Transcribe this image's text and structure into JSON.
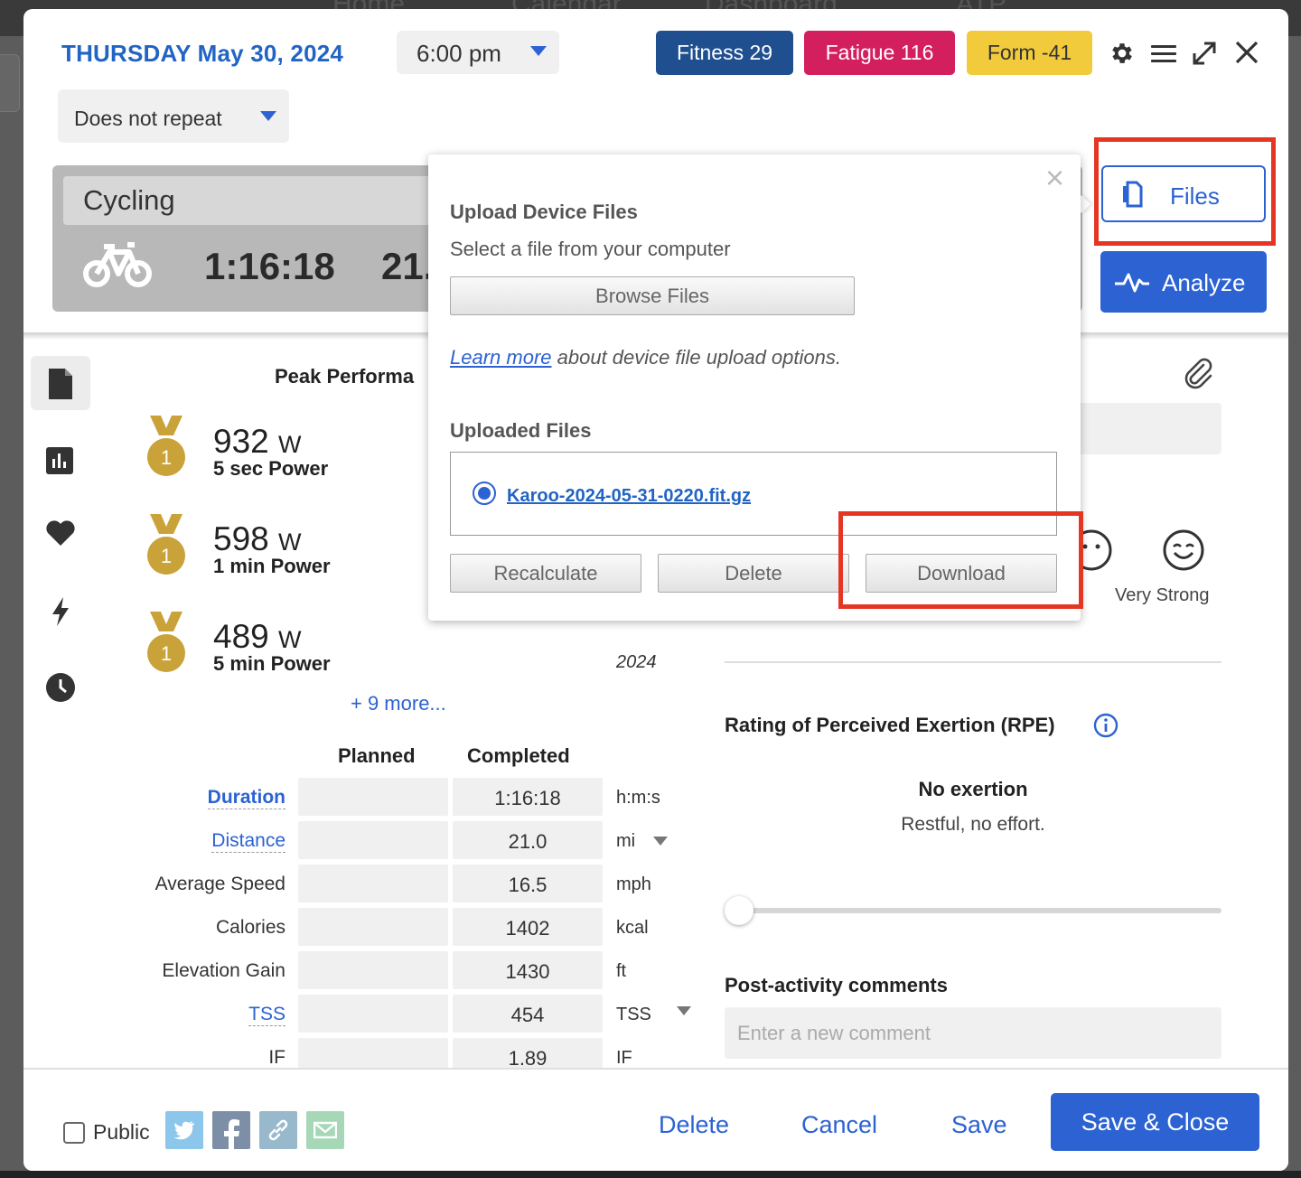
{
  "background_nav": [
    "Home",
    "Calendar",
    "Dashboard",
    "ATP"
  ],
  "header": {
    "date_day": "THURSDAY",
    "date_rest": "May 30, 2024",
    "time": "6:00 pm",
    "repeat": "Does not repeat",
    "badges": {
      "fitness": "Fitness 29",
      "fatigue": "Fatigue 116",
      "form": "Form -41"
    }
  },
  "tile": {
    "sport": "Cycling",
    "duration": "1:16:18",
    "distance_partial": "21."
  },
  "actions": {
    "files": "Files",
    "analyze": "Analyze"
  },
  "peak": {
    "title": "Peak Performa",
    "items": [
      {
        "rank": "1",
        "value": "932",
        "unit": "W",
        "label": "5 sec Power"
      },
      {
        "rank": "1",
        "value": "598",
        "unit": "W",
        "label": "1 min Power"
      },
      {
        "rank": "1",
        "value": "489",
        "unit": "W",
        "label": "5 min Power"
      }
    ],
    "year": "2024",
    "more": "+ 9 more..."
  },
  "metrics": {
    "col_planned": "Planned",
    "col_completed": "Completed",
    "rows": [
      {
        "label": "Duration",
        "planned": "",
        "completed": "1:16:18",
        "unit": "h:m:s"
      },
      {
        "label": "Distance",
        "planned": "",
        "completed": "21.0",
        "unit": "mi"
      },
      {
        "label": "Average Speed",
        "planned": "",
        "completed": "16.5",
        "unit": "mph"
      },
      {
        "label": "Calories",
        "planned": "",
        "completed": "1402",
        "unit": "kcal"
      },
      {
        "label": "Elevation Gain",
        "planned": "",
        "completed": "1430",
        "unit": "ft"
      },
      {
        "label": "TSS",
        "planned": "",
        "completed": "454",
        "unit": "TSS"
      },
      {
        "label": "IF",
        "planned": "",
        "completed": "1.89",
        "unit": "IF"
      }
    ]
  },
  "feel": {
    "label": "Very Strong"
  },
  "rpe": {
    "title": "Rating of Perceived Exertion (RPE)",
    "value": "No exertion",
    "description": "Restful, no effort.",
    "level": 0
  },
  "comments": {
    "title": "Post-activity comments",
    "placeholder": "Enter a new comment"
  },
  "footer": {
    "public": "Public",
    "delete": "Delete",
    "cancel": "Cancel",
    "save": "Save",
    "save_close": "Save & Close"
  },
  "popover": {
    "title": "Upload Device Files",
    "subtitle": "Select a file from your computer",
    "browse": "Browse Files",
    "learn_link": "Learn more",
    "learn_rest": " about device file upload options.",
    "uploaded_title": "Uploaded Files",
    "file": "Karoo-2024-05-31-0220.fit.gz",
    "recalculate": "Recalculate",
    "delete": "Delete",
    "download": "Download"
  },
  "colors": {
    "accent": "#2c62d2",
    "fitness": "#1f4f8f",
    "fatigue": "#d41f5f",
    "form": "#f2cb3c",
    "highlight": "#e53624"
  }
}
